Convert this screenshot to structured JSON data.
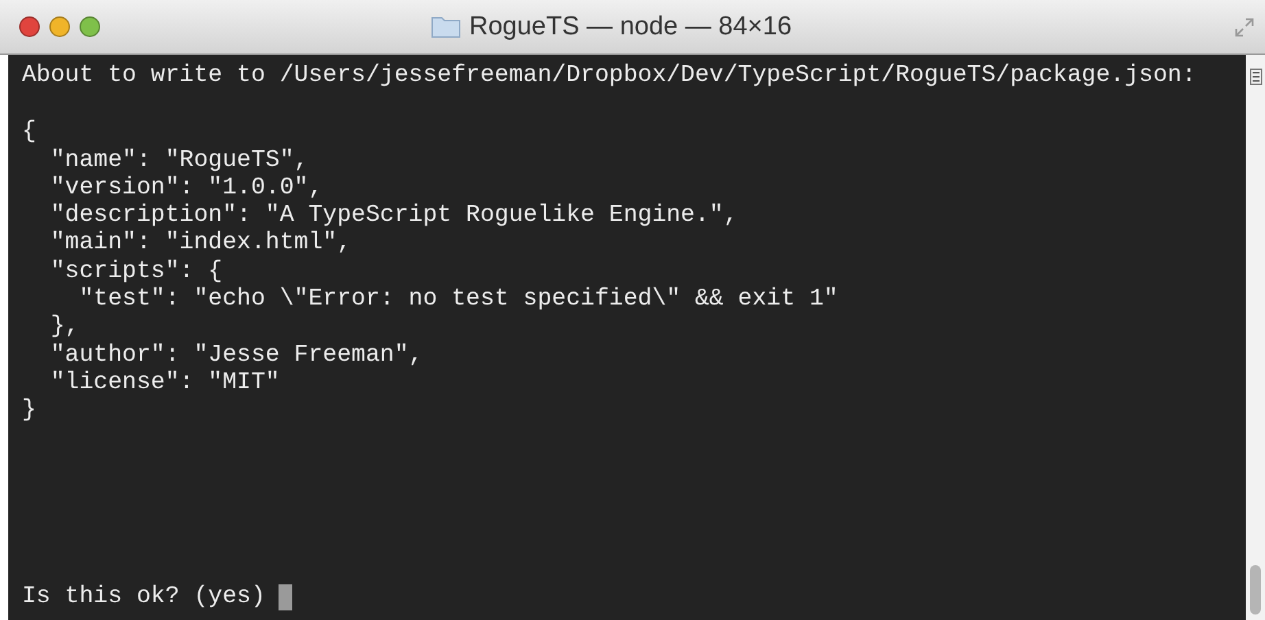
{
  "window": {
    "title": "RogueTS — node — 84×16"
  },
  "terminal": {
    "header": "About to write to /Users/jessefreeman/Dropbox/Dev/TypeScript/RogueTS/package.json:",
    "body": [
      "{",
      "  \"name\": \"RogueTS\",",
      "  \"version\": \"1.0.0\",",
      "  \"description\": \"A TypeScript Roguelike Engine.\",",
      "  \"main\": \"index.html\",",
      "  \"scripts\": {",
      "    \"test\": \"echo \\\"Error: no test specified\\\" && exit 1\"",
      "  },",
      "  \"author\": \"Jesse Freeman\",",
      "  \"license\": \"MIT\"",
      "}"
    ],
    "prompt": "Is this ok? (yes)"
  }
}
